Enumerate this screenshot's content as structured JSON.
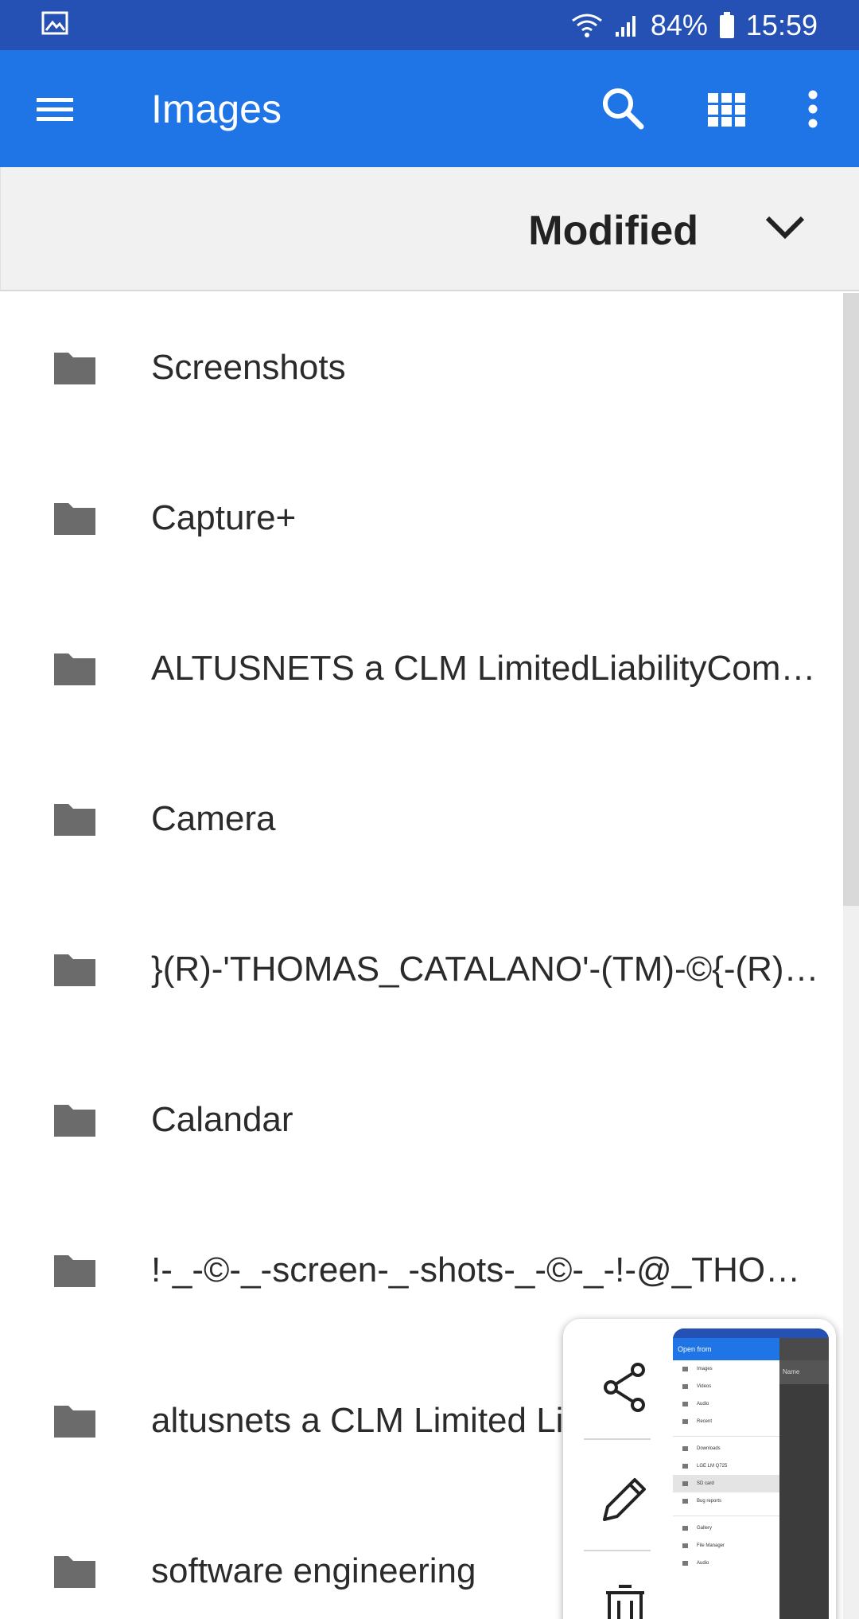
{
  "status_bar": {
    "battery_percent": "84%",
    "time": "15:59",
    "icons": [
      "gallery-icon",
      "wifi-icon",
      "signal-icon",
      "battery-icon"
    ]
  },
  "app_bar": {
    "title": "Images",
    "icons": [
      "menu-icon",
      "search-icon",
      "grid-view-icon",
      "more-vert-icon"
    ]
  },
  "sort_bar": {
    "label": "Modified"
  },
  "folders": [
    "Screenshots",
    "Capture+",
    "ALTUSNETS a CLM LimitedLiabilityCom…",
    "Camera",
    "}(R)-'THOMAS_CATALANO'-(TM)-©{-(R)-…",
    "Calandar",
    "!-_-©-_-screen-_-shots-_-©-_-!-@_THOM…",
    "altusnets a CLM Limited Liability Company",
    "software engineering"
  ],
  "screenshot_preview": {
    "actions": [
      "share-icon",
      "edit-icon",
      "delete-icon"
    ],
    "thumb_header": "Open from",
    "thumb_sort": "Name",
    "thumb_items": [
      "Images",
      "Videos",
      "Audio",
      "Recent",
      "Downloads",
      "LGE LM Q725",
      "SD card",
      "Bug reports",
      "Gallery",
      "File Manager",
      "Audio"
    ]
  }
}
